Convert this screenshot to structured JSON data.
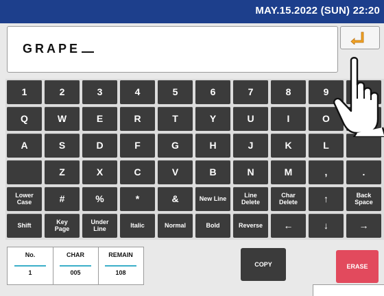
{
  "header": {
    "datetime": "MAY.15.2022 (SUN)  22:20"
  },
  "input": {
    "value": "GRAPE"
  },
  "enter_icon": "enter-return-icon",
  "keys": {
    "row1": [
      "1",
      "2",
      "3",
      "4",
      "5",
      "6",
      "7",
      "8",
      "9",
      "0"
    ],
    "row2": [
      "Q",
      "W",
      "E",
      "R",
      "T",
      "Y",
      "U",
      "I",
      "O",
      "P"
    ],
    "row3": [
      "A",
      "S",
      "D",
      "F",
      "G",
      "H",
      "J",
      "K",
      "L",
      ""
    ],
    "row4": [
      "",
      "Z",
      "X",
      "C",
      "V",
      "B",
      "N",
      "M",
      ",",
      "."
    ],
    "row5": [
      "Lower\nCase",
      "#",
      "%",
      "*",
      "&",
      "New Line",
      "Line\nDelete",
      "Char\nDelete",
      "↑",
      "Back\nSpace"
    ],
    "row6": [
      "Shift",
      "Key\nPage",
      "Under\nLine",
      "Italic",
      "Normal",
      "Bold",
      "Reverse",
      "←",
      "↓",
      "→"
    ]
  },
  "counter": {
    "no_label": "No.",
    "no_value": "1",
    "char_label": "CHAR",
    "char_value": "005",
    "remain_label": "REMAIN",
    "remain_value": "108"
  },
  "buttons": {
    "copy": "COPY",
    "erase": "ERASE"
  },
  "hand_icon": "pointing-hand-icon",
  "colors": {
    "topbar": "#1d3f8c",
    "key": "#3b3b3b",
    "erase": "#e24a5d",
    "accent": "#3aaec8"
  }
}
